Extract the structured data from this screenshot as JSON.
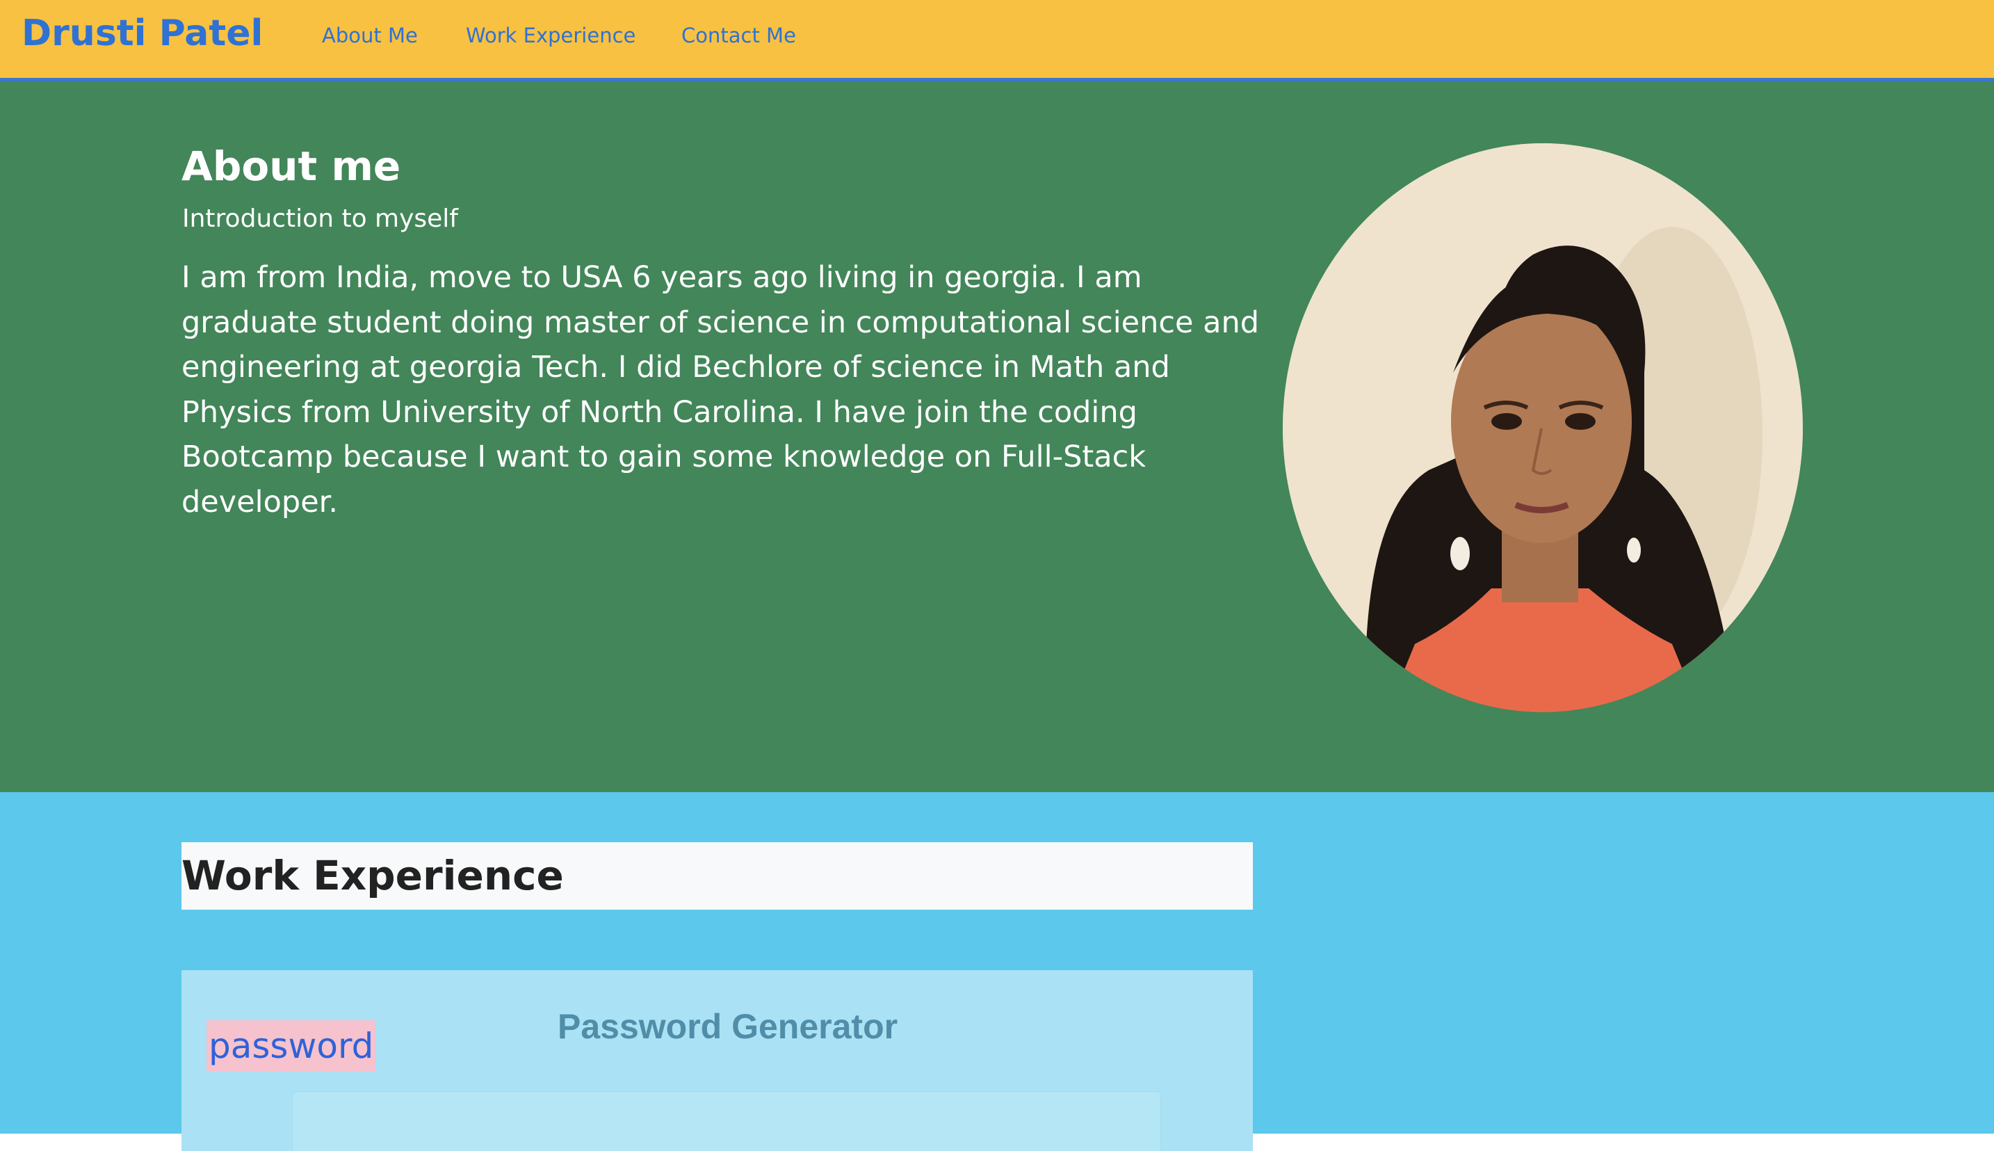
{
  "navbar": {
    "brand": "Drusti Patel",
    "links": [
      {
        "label": "About Me"
      },
      {
        "label": "Work Experience"
      },
      {
        "label": "Contact Me"
      }
    ]
  },
  "about": {
    "title": "About me",
    "subtitle": "Introduction to myself",
    "body": "I am from India, move to USA 6 years ago living in georgia. I am graduate student doing master of science in computational science and engineering at georgia Tech. I did Bechlore of science in Math and Physics from University of North Carolina. I have join the coding Bootcamp because I want to gain some knowledge on Full-Stack developer."
  },
  "work": {
    "title": "Work Experience",
    "project": {
      "label": "password",
      "screenshot_heading": "Password Generator"
    }
  },
  "colors": {
    "navbar_bg": "#f8c141",
    "brand": "#2f72d3",
    "about_bg": "#428659",
    "work_bg": "#5bc8ec"
  }
}
